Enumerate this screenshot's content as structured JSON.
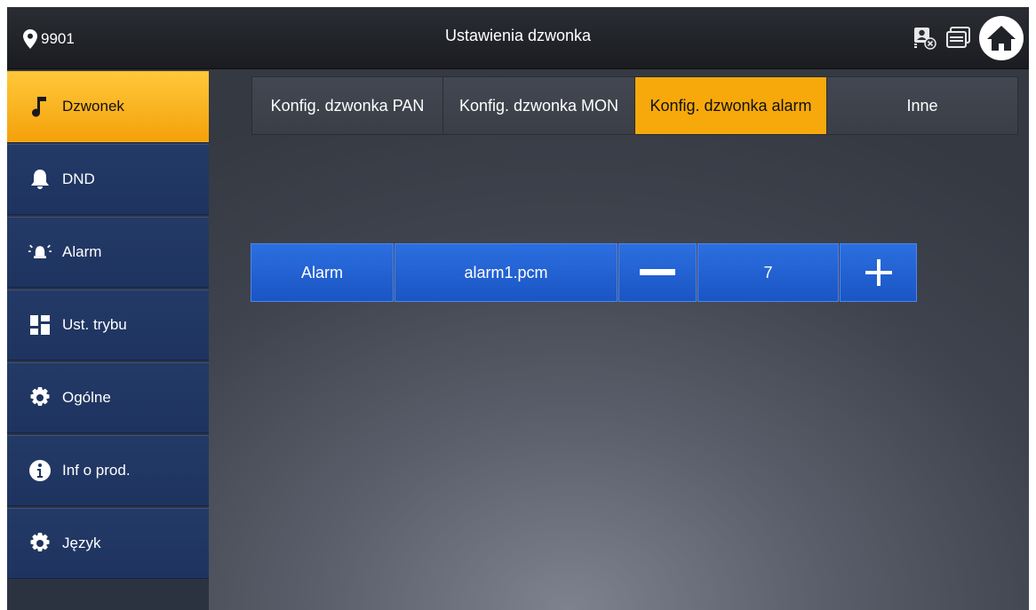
{
  "header": {
    "location": "9901",
    "title": "Ustawienia dzwonka",
    "icons": [
      "camera-monitor-icon",
      "message-icon",
      "home-icon"
    ]
  },
  "sidebar": {
    "items": [
      {
        "label": "Dzwonek",
        "icon": "music-note-icon",
        "active": true
      },
      {
        "label": "DND",
        "icon": "bell-icon",
        "active": false
      },
      {
        "label": "Alarm",
        "icon": "alarm-icon",
        "active": false
      },
      {
        "label": "Ust. trybu",
        "icon": "mode-grid-icon",
        "active": false
      },
      {
        "label": "Ogólne",
        "icon": "gear-icon",
        "active": false
      },
      {
        "label": "Inf o prod.",
        "icon": "info-icon",
        "active": false
      },
      {
        "label": "Język",
        "icon": "gear-icon",
        "active": false
      }
    ]
  },
  "tabs": [
    {
      "label": "Konfig. dzwonka PAN",
      "active": false
    },
    {
      "label": "Konfig. dzwonka MON",
      "active": false
    },
    {
      "label": "Konfig. dzwonka alarm",
      "active": true
    },
    {
      "label": "Inne",
      "active": false
    }
  ],
  "alarm_row": {
    "label": "Alarm",
    "ringtone": "alarm1.pcm",
    "volume": "7"
  },
  "colors": {
    "accent": "#f7a90c",
    "button_blue": "#1a55c4",
    "sidebar_blue": "#1e3360"
  }
}
